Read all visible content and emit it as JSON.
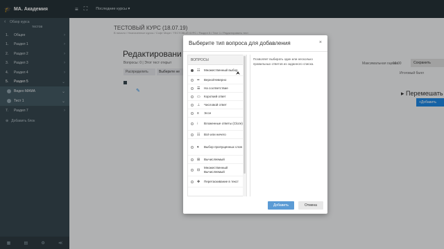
{
  "topbar": {
    "brand": "MA. Академия",
    "recent_courses": "Последние курсы ▾"
  },
  "sidebar": {
    "back_label": "Обзор курса",
    "back_label_2": "тестов",
    "items": [
      {
        "num": "1.",
        "label": "Общее"
      },
      {
        "num": "1.",
        "label": "Раздел 1"
      },
      {
        "num": "2.",
        "label": "Раздел 2"
      },
      {
        "num": "3.",
        "label": "Раздел 3"
      },
      {
        "num": "4.",
        "label": "Раздел 4"
      },
      {
        "num": "5.",
        "label": "Раздел 5"
      }
    ],
    "sub_items": [
      {
        "label": "Видео MAMA"
      },
      {
        "label": "Тест 1"
      }
    ],
    "item_7": {
      "num": "7.",
      "label": "Раздел 7"
    },
    "add_block": "Добавить блок"
  },
  "main": {
    "course_title": "ТЕСТОВЫЙ КУРС (18.07.19)",
    "breadcrumb": "В начало / Назначенные курсы / Софт Маре / ТЕСТОВЫЙ КУРС / Раздел 5 / Тест 1 / Редактировать тест",
    "edit_title": "Редактировани",
    "questions_info": "Вопросы: 0 | Этот тест открыт",
    "repaginate": "Распределить",
    "select_multiple": "Выберите не",
    "max_grade_label": "Максимальная оценка",
    "max_grade_value": "10.00",
    "save": "Сохранить",
    "total_grade": "Итоговый балл",
    "move": "Перемешать",
    "add": "Добавить"
  },
  "modal": {
    "title": "Выберите тип вопроса для добавления",
    "types_heading": "ВОПРОСЫ",
    "description": "Позволяет выбирать один или несколько правильных ответов из заданного списка.",
    "question_types": [
      {
        "label": "Множественный выбор",
        "icon": "list-radio-icon",
        "glyph": "☷",
        "checked": true
      },
      {
        "label": "Верно/Неверно",
        "icon": "dots-icon",
        "glyph": "••",
        "checked": false
      },
      {
        "label": "На соответствие",
        "icon": "match-icon",
        "glyph": "☰",
        "checked": false
      },
      {
        "label": "Короткий ответ",
        "icon": "short-answer-icon",
        "glyph": "▭",
        "checked": false
      },
      {
        "label": "Числовой ответ",
        "icon": "numeric-icon",
        "glyph": "⊥",
        "checked": false
      },
      {
        "label": "Эссе",
        "icon": "essay-icon",
        "glyph": "≡",
        "checked": false
      },
      {
        "label": "Вложенные ответы (Cloze)",
        "icon": "cloze-icon",
        "glyph": "⁝",
        "checked": false
      },
      {
        "label": "Всё или ничего",
        "icon": "all-or-nothing-icon",
        "glyph": "☷",
        "checked": false
      },
      {
        "label": "Выбор пропущенных слов",
        "icon": "dropdown-icon",
        "glyph": "▾",
        "checked": false
      },
      {
        "label": "Вычисляемый",
        "icon": "calculated-icon",
        "glyph": "⊞",
        "checked": false
      },
      {
        "label": "Множественный Вычисляемый",
        "icon": "calc-multi-icon",
        "glyph": "⊟",
        "checked": false
      },
      {
        "label": "Перетаскивание в текст",
        "icon": "drag-icon",
        "glyph": "✥",
        "checked": false
      }
    ],
    "add_button": "Добавить",
    "cancel_button": "Отмена"
  }
}
